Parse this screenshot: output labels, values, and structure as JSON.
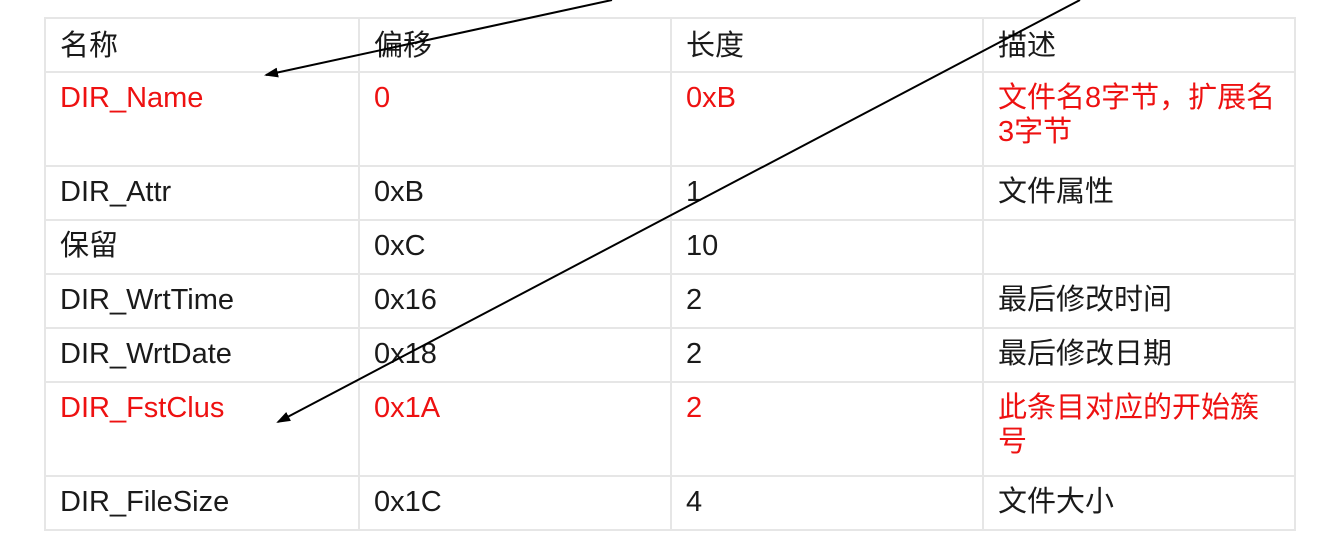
{
  "table": {
    "header": [
      "名称",
      "偏移",
      "长度",
      "描述"
    ],
    "rows": [
      {
        "name": "DIR_Name",
        "offset": "0",
        "length": "0xB",
        "desc": "文件名8字节，扩展名3字节",
        "highlight": true
      },
      {
        "name": "DIR_Attr",
        "offset": "0xB",
        "length": "1",
        "desc": "文件属性",
        "highlight": false
      },
      {
        "name": "保留",
        "offset": "0xC",
        "length": "10",
        "desc": "",
        "highlight": false
      },
      {
        "name": "DIR_WrtTime",
        "offset": "0x16",
        "length": "2",
        "desc": "最后修改时间",
        "highlight": false
      },
      {
        "name": "DIR_WrtDate",
        "offset": "0x18",
        "length": "2",
        "desc": "最后修改日期",
        "highlight": false
      },
      {
        "name": "DIR_FstClus",
        "offset": "0x1A",
        "length": "2",
        "desc": "此条目对应的开始簇号",
        "highlight": true
      },
      {
        "name": "DIR_FileSize",
        "offset": "0x1C",
        "length": "4",
        "desc": "文件大小",
        "highlight": false
      }
    ]
  },
  "colors": {
    "highlight_text": "#ee1111",
    "normal_text": "#1a1a1a",
    "grid_line": "#e6e6e6",
    "arrow": "#000000"
  },
  "annotations": [
    {
      "name": "arrow-to-dir-name",
      "points_to": "DIR_Name"
    },
    {
      "name": "arrow-to-dir-fstclus",
      "points_to": "DIR_FstClus"
    }
  ]
}
